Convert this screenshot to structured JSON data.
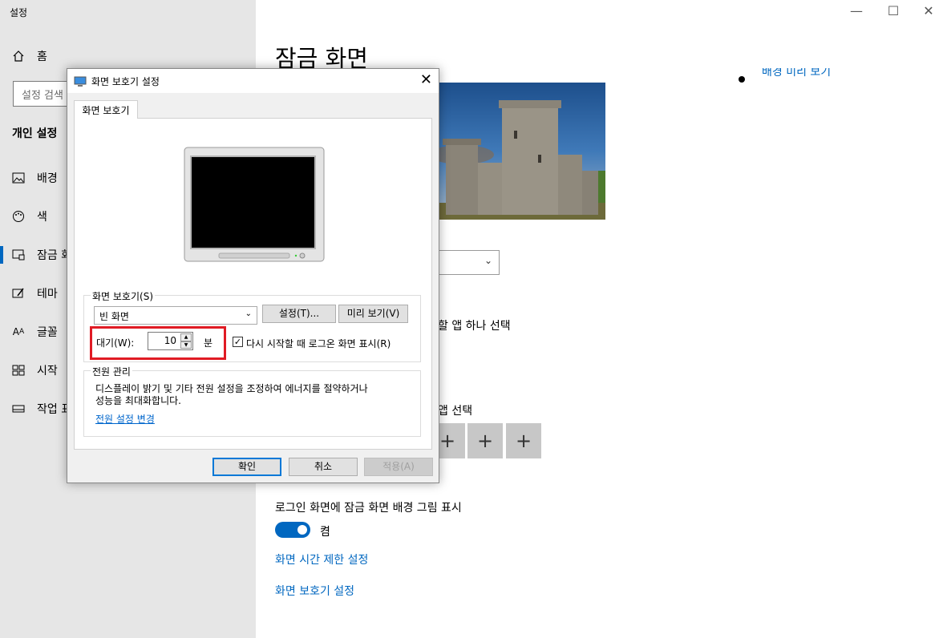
{
  "settings_app": {
    "title": "설정",
    "home_label": "홈",
    "search_placeholder": "설정 검색",
    "section_heading": "개인 설정",
    "nav_items": [
      {
        "label": "배경",
        "icon": "picture-icon"
      },
      {
        "label": "색",
        "icon": "palette-icon"
      },
      {
        "label": "잠금 화면",
        "icon": "lock-screen-icon"
      },
      {
        "label": "테마",
        "icon": "theme-brush-icon"
      },
      {
        "label": "글꼴",
        "icon": "font-icon"
      },
      {
        "label": "시작",
        "icon": "start-grid-icon"
      },
      {
        "label": "작업 표시줄",
        "icon": "taskbar-icon"
      }
    ],
    "page_title": "잠금 화면",
    "partial_link_top": "배경 미리 보기",
    "choose_app_text_partial": "할 앱 하나 선택",
    "choose_apps_text_partial": "앱 선택",
    "plus_tiles": [
      "+",
      "+",
      "+"
    ],
    "logon_background_label": "로그인 화면에 잠금 화면 배경 그림 표시",
    "toggle_state": "켬",
    "toggle_on": true,
    "screen_timeout_link": "화면 시간 제한 설정",
    "screensaver_link": "화면 보호기 설정",
    "accent_color": "#0067c0"
  },
  "dialog": {
    "title": "화면 보호기 설정",
    "tab_label": "화면 보호기",
    "screensaver_group_label": "화면 보호기(S)",
    "screensaver_selected": "빈 화면",
    "settings_button": "설정(T)...",
    "preview_button": "미리 보기(V)",
    "wait_label": "대기(W):",
    "wait_value": "10",
    "wait_unit": "분",
    "resume_checkbox_label": "다시 시작할 때 로그온 화면 표시(R)",
    "resume_checked": true,
    "power_group_label": "전원 관리",
    "power_desc_line1": "디스플레이 밝기 및 기타 전원 설정을 조정하여 에너지를 절약하거나",
    "power_desc_line2": "성능을 최대화합니다.",
    "power_link": "전원 설정 변경",
    "ok_button": "확인",
    "cancel_button": "취소",
    "apply_button": "적용(A)",
    "highlight_color": "#e01b24"
  }
}
